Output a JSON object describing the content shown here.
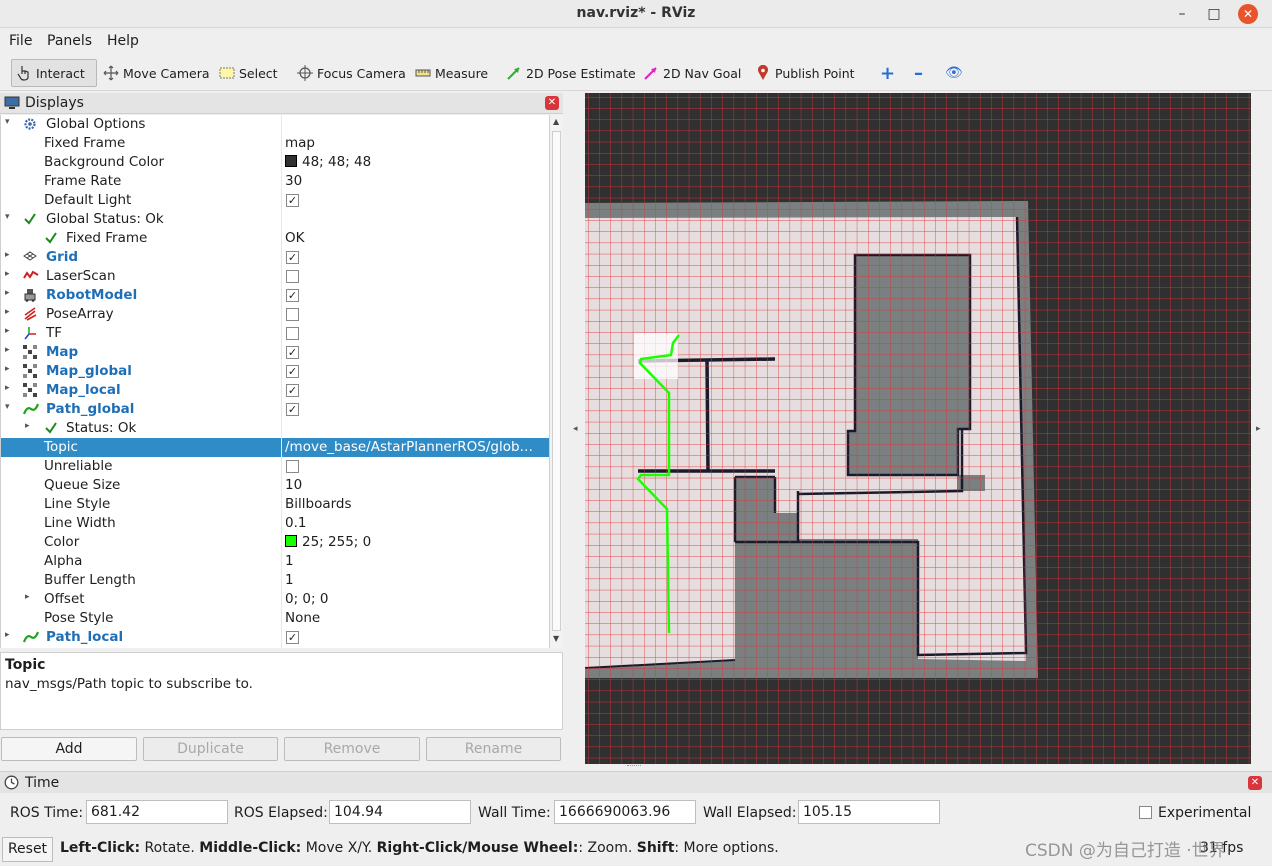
{
  "window": {
    "title": "nav.rviz* - RViz",
    "minimize": "–",
    "maximize": "□",
    "close": "✕"
  },
  "menu": {
    "file": "File",
    "panels": "Panels",
    "help": "Help"
  },
  "toolbar": {
    "interact": "Interact",
    "move_camera": "Move Camera",
    "select": "Select",
    "focus_camera": "Focus Camera",
    "measure": "Measure",
    "pose_estimate": "2D Pose Estimate",
    "nav_goal": "2D Nav Goal",
    "publish_point": "Publish Point",
    "add_tool": "+",
    "remove_tool": "–",
    "view_tool": "👁"
  },
  "displays": {
    "title": "Displays",
    "rows": [
      {
        "name": "Global Options",
        "value": ""
      },
      {
        "name": "Fixed Frame",
        "value": "map"
      },
      {
        "name": "Background Color",
        "value": "48; 48; 48",
        "swatch": "#303030"
      },
      {
        "name": "Frame Rate",
        "value": "30"
      },
      {
        "name": "Default Light",
        "checked": true
      },
      {
        "name": "Global Status: Ok",
        "value": ""
      },
      {
        "name": "Fixed Frame",
        "value": "OK"
      },
      {
        "name": "Grid",
        "checked": true
      },
      {
        "name": "LaserScan",
        "checked": false
      },
      {
        "name": "RobotModel",
        "checked": true
      },
      {
        "name": "PoseArray",
        "checked": false
      },
      {
        "name": "TF",
        "checked": false
      },
      {
        "name": "Map",
        "checked": true
      },
      {
        "name": "Map_global",
        "checked": true
      },
      {
        "name": "Map_local",
        "checked": true
      },
      {
        "name": "Path_global",
        "checked": true
      },
      {
        "name": "Status: Ok",
        "value": ""
      },
      {
        "name": "Topic",
        "value": "/move_base/AstarPlannerROS/glob…"
      },
      {
        "name": "Unreliable",
        "checked": false
      },
      {
        "name": "Queue Size",
        "value": "10"
      },
      {
        "name": "Line Style",
        "value": "Billboards"
      },
      {
        "name": "Line Width",
        "value": "0.1"
      },
      {
        "name": "Color",
        "value": "25; 255; 0",
        "swatch": "#19ff00"
      },
      {
        "name": "Alpha",
        "value": "1"
      },
      {
        "name": "Buffer Length",
        "value": "1"
      },
      {
        "name": "Offset",
        "value": "0; 0; 0"
      },
      {
        "name": "Pose Style",
        "value": "None"
      },
      {
        "name": "Path_local",
        "checked": true
      }
    ]
  },
  "description": {
    "title": "Topic",
    "text": "nav_msgs/Path topic to subscribe to."
  },
  "buttons": {
    "add": "Add",
    "duplicate": "Duplicate",
    "remove": "Remove",
    "rename": "Rename"
  },
  "time": {
    "title": "Time",
    "ros_time_label": "ROS Time:",
    "ros_time": "681.42",
    "ros_elapsed_label": "ROS Elapsed:",
    "ros_elapsed": "104.94",
    "wall_time_label": "Wall Time:",
    "wall_time": "1666690063.96",
    "wall_elapsed_label": "Wall Elapsed:",
    "wall_elapsed": "105.15",
    "experimental": "Experimental"
  },
  "status": {
    "reset": "Reset",
    "hint_b1": "Left-Click:",
    "hint_t1": " Rotate. ",
    "hint_b2": "Middle-Click:",
    "hint_t2": " Move X/Y. ",
    "hint_b3": "Right-Click/Mouse Wheel:",
    "hint_t3": ": Zoom. ",
    "hint_b4": "Shift",
    "hint_t4": ": More options.",
    "fps": "31 fps"
  },
  "watermark": "CSDN @为自己打造 ·世界",
  "colors": {
    "path": "#19ff00",
    "selection": "#308cc6",
    "grid": "#e0323c",
    "free": "#e6dede",
    "occupied": "#7a7f7f"
  }
}
